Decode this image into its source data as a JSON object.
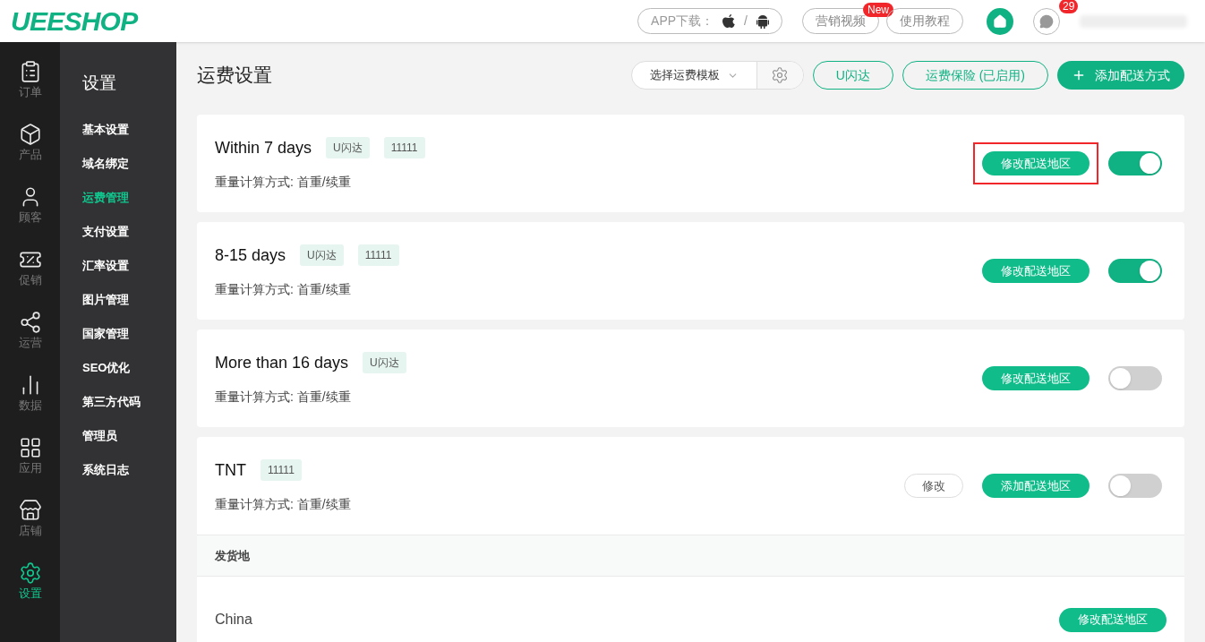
{
  "header": {
    "logo": "UEESHOP",
    "app_download": {
      "label": "APP下载：",
      "separator": "/"
    },
    "buttons": [
      {
        "label": "营销视频",
        "badge": "New"
      },
      {
        "label": "使用教程"
      }
    ],
    "messages_badge": "29"
  },
  "rail": [
    {
      "label": "订单",
      "selected": false
    },
    {
      "label": "产品",
      "selected": false
    },
    {
      "label": "顾客",
      "selected": false
    },
    {
      "label": "促销",
      "selected": false
    },
    {
      "label": "运营",
      "selected": false
    },
    {
      "label": "数据",
      "selected": false
    },
    {
      "label": "应用",
      "selected": false
    },
    {
      "label": "店铺",
      "selected": false
    },
    {
      "label": "设置",
      "selected": true
    }
  ],
  "submenu": {
    "title": "设置",
    "items": [
      {
        "label": "基本设置",
        "selected": false
      },
      {
        "label": "域名绑定",
        "selected": false
      },
      {
        "label": "运费管理",
        "selected": true
      },
      {
        "label": "支付设置",
        "selected": false
      },
      {
        "label": "汇率设置",
        "selected": false
      },
      {
        "label": "图片管理",
        "selected": false
      },
      {
        "label": "国家管理",
        "selected": false
      },
      {
        "label": "SEO优化",
        "selected": false
      },
      {
        "label": "第三方代码",
        "selected": false
      },
      {
        "label": "管理员",
        "selected": false
      },
      {
        "label": "系统日志",
        "selected": false
      }
    ]
  },
  "page": {
    "title": "运费设置",
    "template_select": "选择运费模板",
    "outline_buttons": [
      "U闪达",
      "运费保险 (已启用)"
    ],
    "add_button": "添加配送方式"
  },
  "methods": [
    {
      "name": "Within 7 days",
      "tags": [
        "U闪达",
        "11111"
      ],
      "calc": "重量计算方式: 首重/续重",
      "region_button": "修改配送地区",
      "highlighted": true,
      "on": true
    },
    {
      "name": "8-15 days",
      "tags": [
        "U闪达",
        "11111"
      ],
      "calc": "重量计算方式: 首重/续重",
      "region_button": "修改配送地区",
      "highlighted": false,
      "on": true
    },
    {
      "name": "More than 16 days",
      "tags": [
        "U闪达"
      ],
      "calc": "重量计算方式: 首重/续重",
      "region_button": "修改配送地区",
      "highlighted": false,
      "on": false
    },
    {
      "name": "TNT",
      "tags": [
        "11111"
      ],
      "calc": "重量计算方式: 首重/续重",
      "edit_button": "修改",
      "region_button": "添加配送地区",
      "highlighted": false,
      "on": false,
      "origin": {
        "heading": "发货地",
        "rows": [
          {
            "name": "China",
            "button": "修改配送地区"
          }
        ]
      }
    }
  ]
}
